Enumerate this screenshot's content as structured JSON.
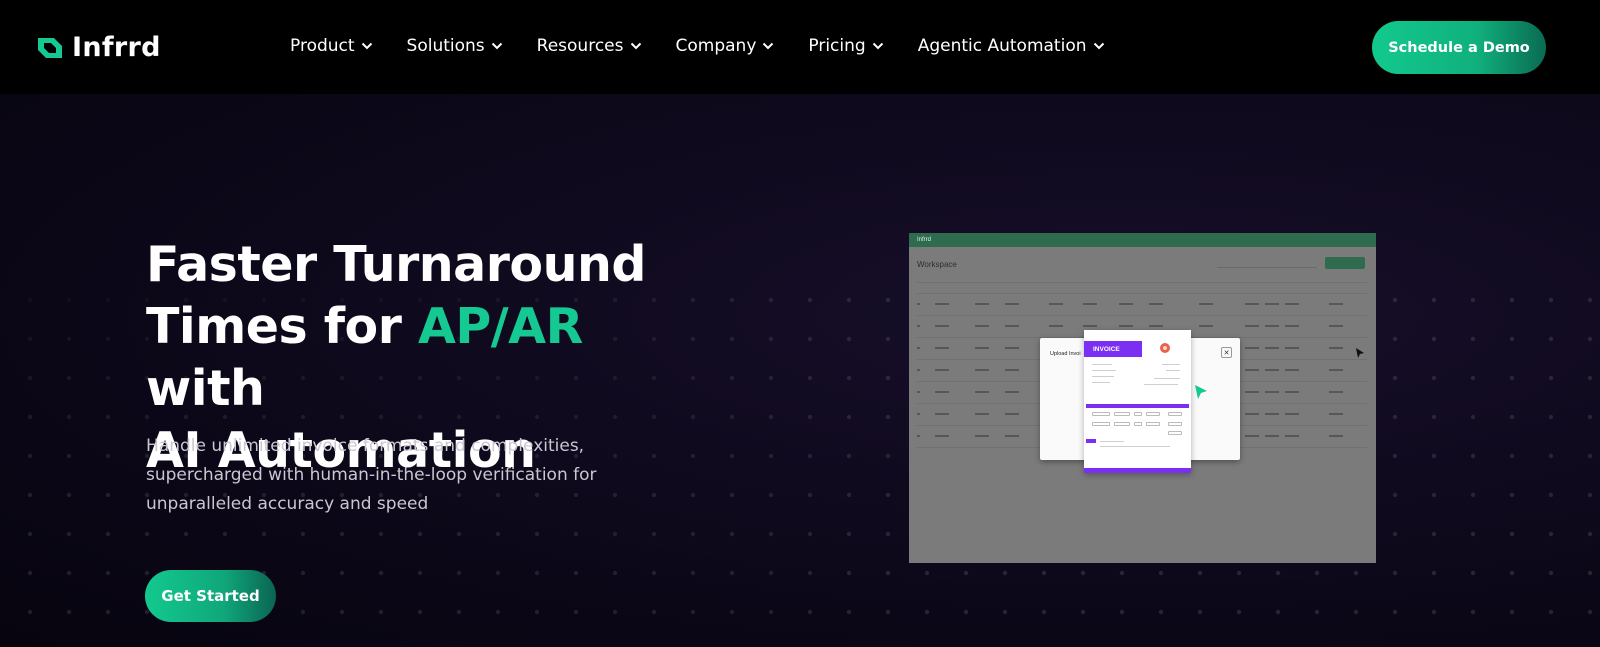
{
  "brand": {
    "name": "Infrrd",
    "accent_color": "#16c992",
    "logo_icon": "infrrd-logo-icon"
  },
  "nav": {
    "items": [
      {
        "label": "Product",
        "icon": "chevron-down-icon"
      },
      {
        "label": "Solutions",
        "icon": "chevron-down-icon"
      },
      {
        "label": "Resources",
        "icon": "chevron-down-icon"
      },
      {
        "label": "Company",
        "icon": "chevron-down-icon"
      },
      {
        "label": "Pricing",
        "icon": "chevron-down-icon"
      },
      {
        "label": "Agentic Automation",
        "icon": "chevron-down-icon"
      }
    ],
    "cta_label": "Schedule a Demo"
  },
  "hero": {
    "headline_line1": "Faster Turnaround",
    "headline_line2_prefix": "Times for ",
    "headline_accent": "AP/AR",
    "headline_line2_suffix": " with",
    "headline_line3": "AI Automation",
    "subtext": "Handle unlimited invoice formats and complexities, supercharged with human-in-the-loop verification for unparalleled accuracy and speed",
    "cta_label": "Get Started"
  },
  "product_screenshot": {
    "app_brand": "Infrrd",
    "workspace_title": "Workspace",
    "modal_title": "Upload Invoi",
    "invoice_tag": "INVOICE",
    "close_glyph": "✕",
    "colors": {
      "app_header": "#2f6b4f",
      "invoice_purple": "#7b2ff2",
      "cursor_green": "#16c992"
    }
  }
}
